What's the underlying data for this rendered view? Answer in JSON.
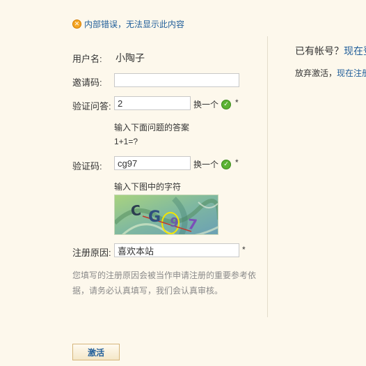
{
  "error": {
    "icon": "error-x-icon",
    "text": "内部错误，无法显示此内容"
  },
  "form": {
    "username": {
      "label": "用户名:",
      "value": "小陶子"
    },
    "invite": {
      "label": "邀请码:",
      "value": ""
    },
    "question": {
      "label": "验证问答:",
      "value": "2",
      "swap_label": "换一个",
      "required_mark": "*",
      "hint": "输入下面问题的答案",
      "question_text": "1+1=?"
    },
    "captcha": {
      "label": "验证码:",
      "value": "cg97",
      "swap_label": "换一个",
      "required_mark": "*",
      "hint": "输入下图中的字符"
    },
    "reason": {
      "label": "注册原因:",
      "value": "喜欢本站",
      "required_mark": "*"
    },
    "note": "您填写的注册原因会被当作申请注册的重要参考依据，请务必认真填写，我们会认真审核。",
    "submit_label": "激活"
  },
  "right": {
    "has_account": "已有帐号？",
    "login_link": "现在登",
    "abandon": "放弃激活，",
    "register_link": "现在注册"
  },
  "colors": {
    "link": "#1f5d99",
    "background": "#fdf8ec",
    "check": "#5bb233",
    "error": "#f5a623"
  }
}
